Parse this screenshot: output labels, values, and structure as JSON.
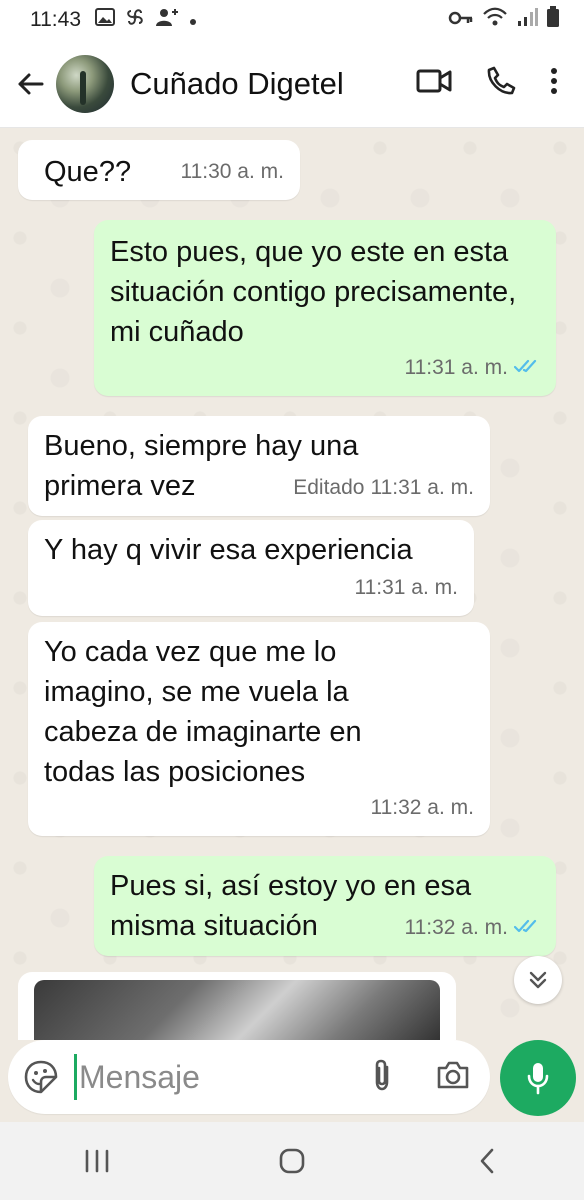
{
  "status": {
    "time": "11:43",
    "left_icons": [
      "image-icon",
      "pinwheel-icon",
      "add-contact-icon",
      "dot-icon"
    ],
    "right_icons": [
      "key-icon",
      "wifi-icon",
      "signal-icon",
      "battery-icon"
    ]
  },
  "header": {
    "contact_name": "Cuñado Digetel",
    "icons": [
      "back-arrow-icon",
      "video-call-icon",
      "phone-icon",
      "more-vert-icon"
    ]
  },
  "messages": [
    {
      "dir": "in",
      "text": "Que??",
      "time": "11:30 a. m.",
      "edited": ""
    },
    {
      "dir": "out",
      "text": "Esto pues, que yo este en esta situación contigo precisamente, mi cuñado",
      "time": "11:31 a. m.",
      "ticks": "read"
    },
    {
      "dir": "in",
      "text": "Bueno, siempre hay una primera vez",
      "time": "11:31 a. m.",
      "edited": "Editado"
    },
    {
      "dir": "in",
      "text": "Y hay q vivir esa experiencia",
      "time": "11:31 a. m.",
      "edited": ""
    },
    {
      "dir": "in",
      "text": "Yo cada vez que me lo imagino, se me vuela la cabeza de imaginarte en todas las posiciones",
      "time": "11:32 a. m.",
      "edited": ""
    },
    {
      "dir": "out",
      "text": "Pues si, así estoy yo en esa misma situación",
      "time": "11:32 a. m.",
      "ticks": "read"
    }
  ],
  "composer": {
    "placeholder": "Mensaje"
  },
  "colors": {
    "accent": "#1daa61",
    "outgoing_bubble": "#d9fdd3",
    "incoming_bubble": "#ffffff",
    "chat_background": "#efeae2",
    "read_ticks": "#53bdeb"
  },
  "nav": {
    "icons": [
      "recent-apps-icon",
      "home-icon",
      "back-icon"
    ]
  }
}
